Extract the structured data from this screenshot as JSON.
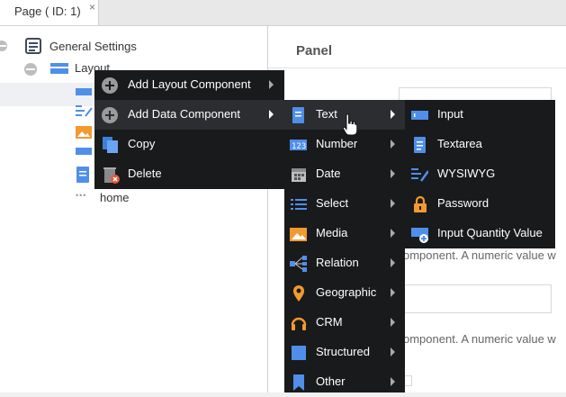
{
  "tab": {
    "title": "Page ( ID: 1)",
    "close": "×"
  },
  "tree": {
    "general_settings": "General Settings",
    "layout": "Layout",
    "home_dots": "•••",
    "home": "home"
  },
  "panel": {
    "title": "Panel",
    "hint1": "omponent. A numeric value w",
    "hint2": "omponent. A numeric value w"
  },
  "menu1": [
    {
      "label": "Add Layout Component",
      "icon": "plus-circle-icon"
    },
    {
      "label": "Add Data Component",
      "icon": "plus-circle-icon"
    },
    {
      "label": "Copy",
      "icon": "copy-icon"
    },
    {
      "label": "Delete",
      "icon": "trash-delete-icon"
    }
  ],
  "menu2": [
    {
      "label": "Text",
      "icon": "text-field-icon"
    },
    {
      "label": "Number",
      "icon": "number-icon"
    },
    {
      "label": "Date",
      "icon": "calendar-icon"
    },
    {
      "label": "Select",
      "icon": "list-icon"
    },
    {
      "label": "Media",
      "icon": "image-icon"
    },
    {
      "label": "Relation",
      "icon": "relation-icon"
    },
    {
      "label": "Geographic",
      "icon": "map-pin-icon"
    },
    {
      "label": "CRM",
      "icon": "headset-icon"
    },
    {
      "label": "Structured",
      "icon": "structured-icon"
    },
    {
      "label": "Other",
      "icon": "bookmark-icon"
    }
  ],
  "menu3": [
    {
      "label": "Input",
      "icon": "input-icon"
    },
    {
      "label": "Textarea",
      "icon": "textarea-icon"
    },
    {
      "label": "WYSIWYG",
      "icon": "wysiwyg-icon"
    },
    {
      "label": "Password",
      "icon": "lock-icon"
    },
    {
      "label": "Input Quantity Value",
      "icon": "input-quantity-icon"
    }
  ],
  "colors": {
    "menu_bg": "#191a1c",
    "menu_highlight": "#2c2d30",
    "accent_blue": "#4f8fea",
    "orange": "#f29a2e"
  }
}
